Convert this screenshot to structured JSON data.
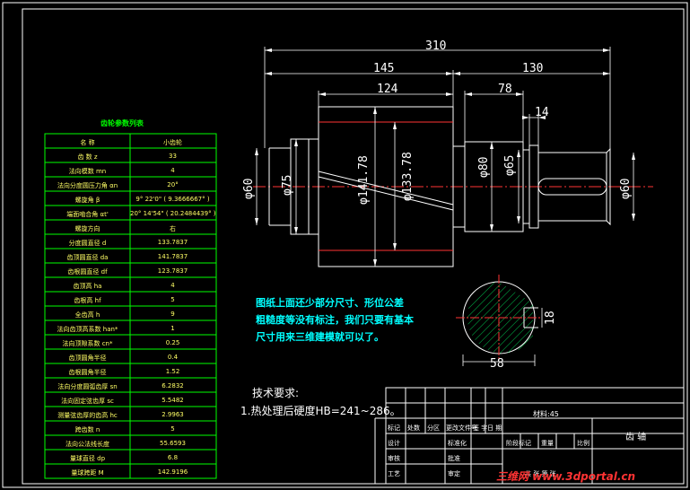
{
  "gear_table": {
    "title": "齿轮参数列表",
    "header": [
      "名  称",
      "小齿轮"
    ],
    "rows": [
      [
        "齿  数 z",
        "33"
      ],
      [
        "法向模数 mn",
        "4"
      ],
      [
        "法向分度圆压力角 αn",
        "20°"
      ],
      [
        "螺旋角 β",
        "9° 22'0\" ( 9.3666667° )"
      ],
      [
        "端面啮合角 αt'",
        "20° 14'54\" ( 20.2484439° )"
      ],
      [
        "螺旋方向",
        "右"
      ],
      [
        "分度圆直径 d",
        "133.7837"
      ],
      [
        "齿顶圆直径 da",
        "141.7837"
      ],
      [
        "齿根圆直径 df",
        "123.7837"
      ],
      [
        "齿顶高 ha",
        "4"
      ],
      [
        "齿根高 hf",
        "5"
      ],
      [
        "全齿高 h",
        "9"
      ],
      [
        "法向齿顶高系数 han*",
        "1"
      ],
      [
        "法向顶隙系数 cn*",
        "0.25"
      ],
      [
        "齿顶圆角半径",
        "0.4"
      ],
      [
        "齿根圆角半径",
        "1.52"
      ],
      [
        "法向分度圆弧齿厚 sn",
        "6.2832"
      ],
      [
        "法向固定弦齿厚 sc",
        "5.5482"
      ],
      [
        "测量弦齿厚的齿高 hc",
        "2.9963"
      ],
      [
        "跨齿数 n",
        "5"
      ],
      [
        "法向公法线长度",
        "55.6593"
      ],
      [
        "量球直径 dp",
        "6.8"
      ],
      [
        "量球跨距 M",
        "142.9196"
      ]
    ]
  },
  "dimensions": {
    "overall_length": "310",
    "left_section": "145",
    "right_section": "130",
    "gear_width": "124",
    "keyway_length": "78",
    "keyway_width": "14",
    "d_left_end": "φ60",
    "d_left_shoulder": "φ75",
    "d_tip": "φ141.78",
    "d_pitch": "φ133.78",
    "d_shoulder_right": "φ80",
    "d_journal_right": "φ65",
    "d_right_end": "φ60",
    "section_depth": "18",
    "section_width": "58"
  },
  "note": {
    "lines": [
      "图纸上面还少部分尺寸、形位公差",
      "粗糙度等没有标注，我们只要有基本",
      "尺寸用来三维建模就可以了。"
    ]
  },
  "tech_req": {
    "heading": "技术要求:",
    "item": "1.热处理后硬度HB=241~286。"
  },
  "title_block": {
    "material": "材料:45",
    "part_name": "齿  轴",
    "row_labels": [
      "标记",
      "处数",
      "分区",
      "更改文件号",
      "签  字",
      "日  期"
    ],
    "left_labels": [
      "设计",
      "审核",
      "工艺"
    ],
    "mid_labels": [
      "标准化",
      "批准",
      "审定",
      "批准"
    ],
    "stage_labels": [
      "阶段标记",
      "重量",
      "比例"
    ],
    "sheet_label": "共    张  第    张"
  },
  "watermark": "三维网 www.3dportal.cn"
}
